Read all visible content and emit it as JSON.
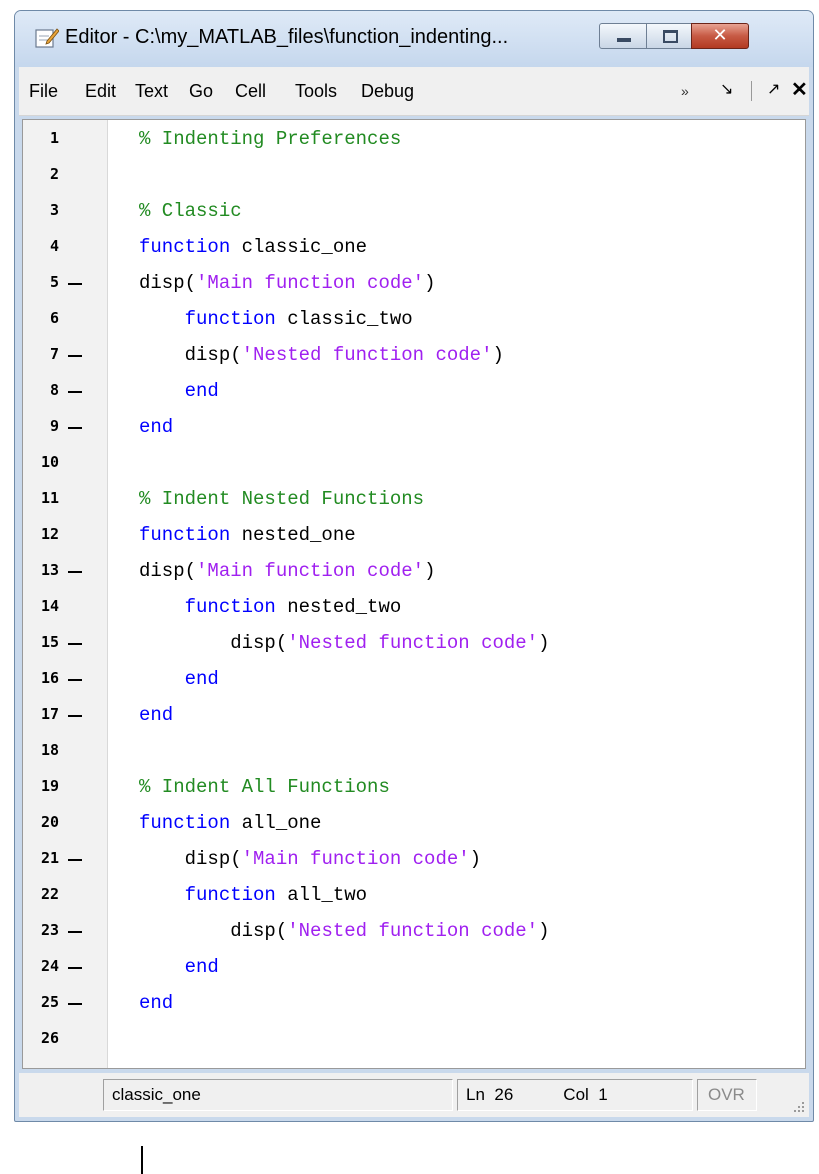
{
  "window": {
    "title": "Editor - C:\\my_MATLAB_files\\function_indenting...",
    "buttons": {
      "minimize": "—",
      "maximize": "□",
      "close": "✕"
    }
  },
  "menu": {
    "items": [
      "File",
      "Edit",
      "Text",
      "Go",
      "Cell",
      "Tools",
      "Debug"
    ],
    "more": "»",
    "dock": "↘",
    "undock": "↗",
    "close": "✕"
  },
  "code": {
    "lines": [
      {
        "num": "1",
        "bp": false,
        "tokens": [
          [
            "cmt",
            "% Indenting Preferences"
          ]
        ]
      },
      {
        "num": "2",
        "bp": false,
        "tokens": []
      },
      {
        "num": "3",
        "bp": false,
        "tokens": [
          [
            "cmt",
            "% Classic"
          ]
        ]
      },
      {
        "num": "4",
        "bp": false,
        "tokens": [
          [
            "kw",
            "function"
          ],
          [
            "",
            " classic_one"
          ]
        ]
      },
      {
        "num": "5",
        "bp": true,
        "tokens": [
          [
            "",
            "disp("
          ],
          [
            "str",
            "'Main function code'"
          ],
          [
            "",
            ")"
          ]
        ]
      },
      {
        "num": "6",
        "bp": false,
        "tokens": [
          [
            "",
            "    "
          ],
          [
            "kw",
            "function"
          ],
          [
            "",
            " classic_two"
          ]
        ]
      },
      {
        "num": "7",
        "bp": true,
        "tokens": [
          [
            "",
            "    disp("
          ],
          [
            "str",
            "'Nested function code'"
          ],
          [
            "",
            ")"
          ]
        ]
      },
      {
        "num": "8",
        "bp": true,
        "tokens": [
          [
            "",
            "    "
          ],
          [
            "kw",
            "end"
          ]
        ]
      },
      {
        "num": "9",
        "bp": true,
        "tokens": [
          [
            "kw",
            "end"
          ]
        ]
      },
      {
        "num": "10",
        "bp": false,
        "tokens": []
      },
      {
        "num": "11",
        "bp": false,
        "tokens": [
          [
            "cmt",
            "% Indent Nested Functions"
          ]
        ]
      },
      {
        "num": "12",
        "bp": false,
        "tokens": [
          [
            "kw",
            "function"
          ],
          [
            "",
            " nested_one"
          ]
        ]
      },
      {
        "num": "13",
        "bp": true,
        "tokens": [
          [
            "",
            "disp("
          ],
          [
            "str",
            "'Main function code'"
          ],
          [
            "",
            ")"
          ]
        ]
      },
      {
        "num": "14",
        "bp": false,
        "tokens": [
          [
            "",
            "    "
          ],
          [
            "kw",
            "function"
          ],
          [
            "",
            " nested_two"
          ]
        ]
      },
      {
        "num": "15",
        "bp": true,
        "tokens": [
          [
            "",
            "        disp("
          ],
          [
            "str",
            "'Nested function code'"
          ],
          [
            "",
            ")"
          ]
        ]
      },
      {
        "num": "16",
        "bp": true,
        "tokens": [
          [
            "",
            "    "
          ],
          [
            "kw",
            "end"
          ]
        ]
      },
      {
        "num": "17",
        "bp": true,
        "tokens": [
          [
            "kw",
            "end"
          ]
        ]
      },
      {
        "num": "18",
        "bp": false,
        "tokens": []
      },
      {
        "num": "19",
        "bp": false,
        "tokens": [
          [
            "cmt",
            "% Indent All Functions"
          ]
        ]
      },
      {
        "num": "20",
        "bp": false,
        "tokens": [
          [
            "kw",
            "function"
          ],
          [
            "",
            " all_one"
          ]
        ]
      },
      {
        "num": "21",
        "bp": true,
        "tokens": [
          [
            "",
            "    disp("
          ],
          [
            "str",
            "'Main function code'"
          ],
          [
            "",
            ")"
          ]
        ]
      },
      {
        "num": "22",
        "bp": false,
        "tokens": [
          [
            "",
            "    "
          ],
          [
            "kw",
            "function"
          ],
          [
            "",
            " all_two"
          ]
        ]
      },
      {
        "num": "23",
        "bp": true,
        "tokens": [
          [
            "",
            "        disp("
          ],
          [
            "str",
            "'Nested function code'"
          ],
          [
            "",
            ")"
          ]
        ]
      },
      {
        "num": "24",
        "bp": true,
        "tokens": [
          [
            "",
            "    "
          ],
          [
            "kw",
            "end"
          ]
        ]
      },
      {
        "num": "25",
        "bp": true,
        "tokens": [
          [
            "kw",
            "end"
          ]
        ]
      },
      {
        "num": "26",
        "bp": false,
        "tokens": []
      }
    ],
    "colors": {
      "keyword": "#0000ff",
      "string": "#a020f0",
      "comment": "#228b22"
    }
  },
  "status": {
    "function": "classic_one",
    "ln_label": "Ln",
    "ln_value": "26",
    "col_label": "Col",
    "col_value": "1",
    "ovr": "OVR"
  }
}
